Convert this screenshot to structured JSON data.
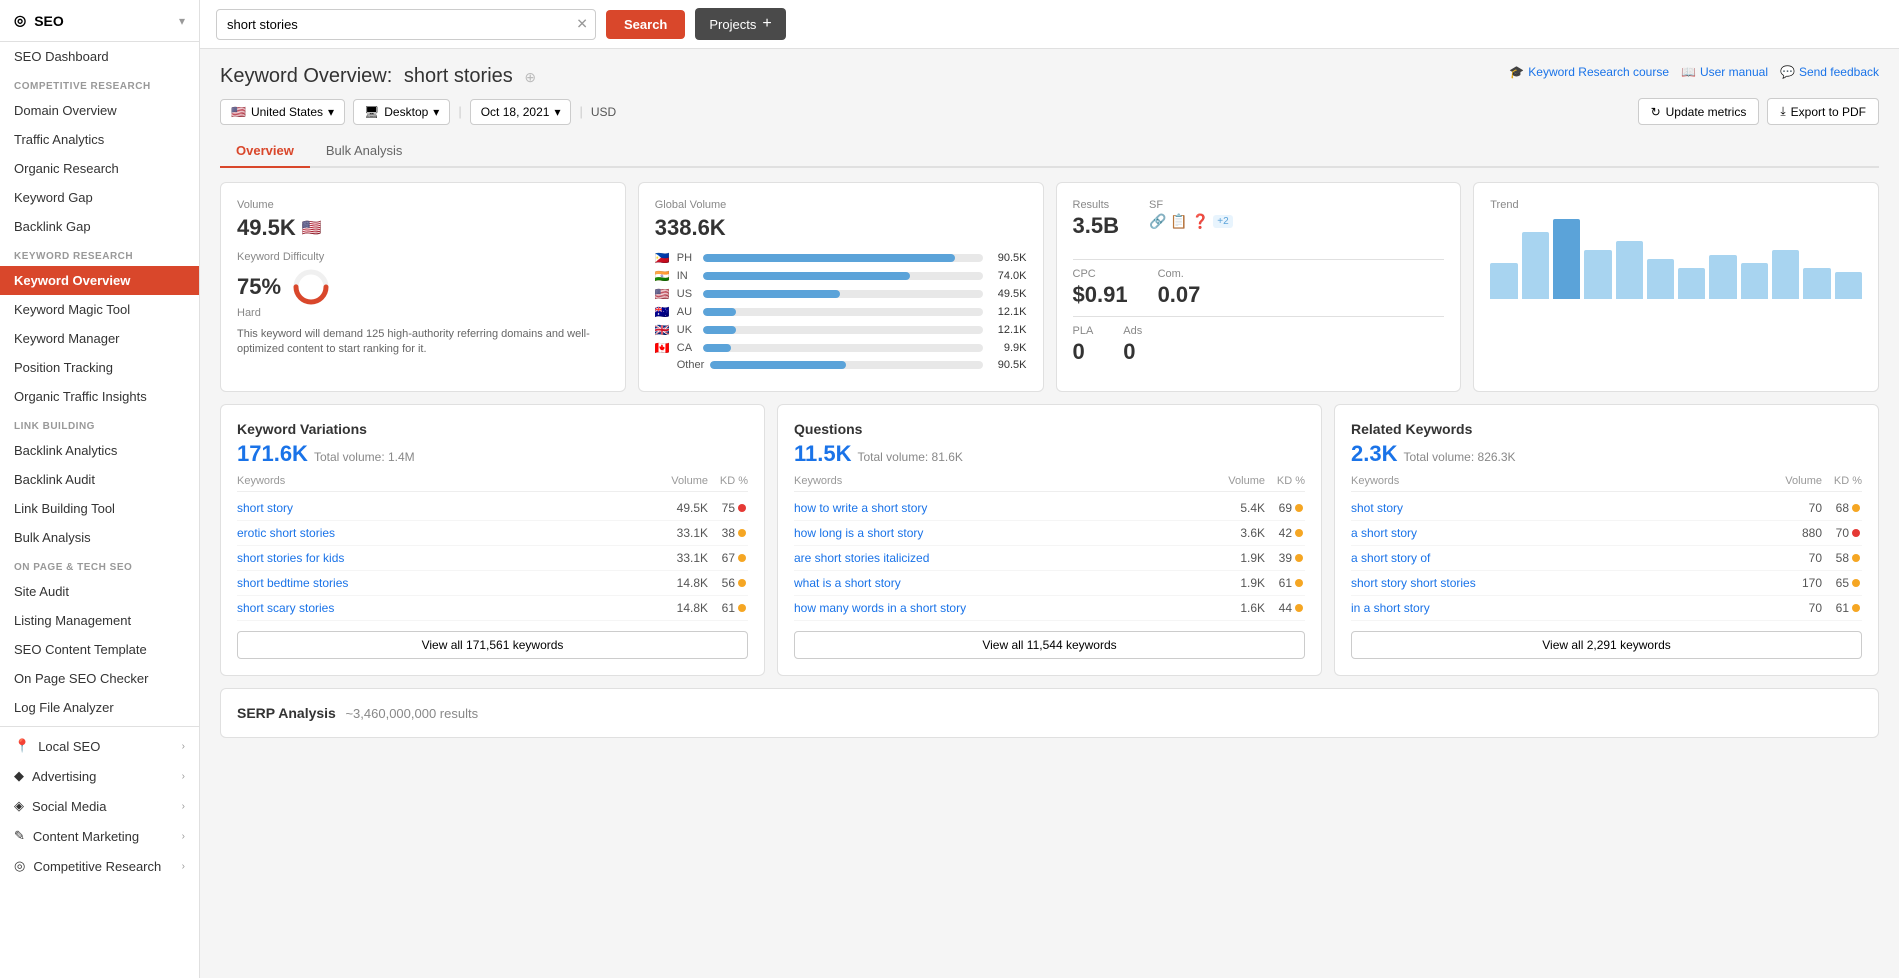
{
  "sidebar": {
    "logo": "SEO",
    "logo_icon": "◎",
    "chevron": "▾",
    "dashboard_item": "SEO Dashboard",
    "sections": [
      {
        "label": "COMPETITIVE RESEARCH",
        "items": [
          {
            "id": "domain-overview",
            "label": "Domain Overview",
            "active": false
          },
          {
            "id": "traffic-analytics",
            "label": "Traffic Analytics",
            "active": false
          },
          {
            "id": "organic-research",
            "label": "Organic Research",
            "active": false
          },
          {
            "id": "keyword-gap",
            "label": "Keyword Gap",
            "active": false
          },
          {
            "id": "backlink-gap",
            "label": "Backlink Gap",
            "active": false
          }
        ]
      },
      {
        "label": "KEYWORD RESEARCH",
        "items": [
          {
            "id": "keyword-overview",
            "label": "Keyword Overview",
            "active": true
          },
          {
            "id": "keyword-magic-tool",
            "label": "Keyword Magic Tool",
            "active": false
          },
          {
            "id": "keyword-manager",
            "label": "Keyword Manager",
            "active": false
          },
          {
            "id": "position-tracking",
            "label": "Position Tracking",
            "active": false
          },
          {
            "id": "organic-traffic-insights",
            "label": "Organic Traffic Insights",
            "active": false
          }
        ]
      },
      {
        "label": "LINK BUILDING",
        "items": [
          {
            "id": "backlink-analytics",
            "label": "Backlink Analytics",
            "active": false
          },
          {
            "id": "backlink-audit",
            "label": "Backlink Audit",
            "active": false
          },
          {
            "id": "link-building-tool",
            "label": "Link Building Tool",
            "active": false
          },
          {
            "id": "bulk-analysis",
            "label": "Bulk Analysis",
            "active": false
          }
        ]
      },
      {
        "label": "ON PAGE & TECH SEO",
        "items": [
          {
            "id": "site-audit",
            "label": "Site Audit",
            "active": false
          },
          {
            "id": "listing-management",
            "label": "Listing Management",
            "active": false
          },
          {
            "id": "seo-content-template",
            "label": "SEO Content Template",
            "active": false
          },
          {
            "id": "on-page-seo-checker",
            "label": "On Page SEO Checker",
            "active": false
          },
          {
            "id": "log-file-analyzer",
            "label": "Log File Analyzer",
            "active": false
          }
        ]
      }
    ],
    "group_items": [
      {
        "id": "local-seo",
        "label": "Local SEO",
        "icon": "📍"
      },
      {
        "id": "advertising",
        "label": "Advertising",
        "icon": "◆"
      },
      {
        "id": "social-media",
        "label": "Social Media",
        "icon": "◈"
      },
      {
        "id": "content-marketing",
        "label": "Content Marketing",
        "icon": "✎"
      },
      {
        "id": "competitive-research",
        "label": "Competitive Research",
        "icon": "◎"
      }
    ]
  },
  "topbar": {
    "search_placeholder": "short stories",
    "search_value": "short stories",
    "search_button": "Search",
    "projects_button": "Projects"
  },
  "page": {
    "title_prefix": "Keyword Overview:",
    "keyword": "short stories",
    "info_icon": "⊕",
    "links": [
      {
        "id": "keyword-research-course",
        "label": "Keyword Research course",
        "icon": "🎓"
      },
      {
        "id": "user-manual",
        "label": "User manual",
        "icon": "📖"
      },
      {
        "id": "send-feedback",
        "label": "Send feedback",
        "icon": "💬"
      }
    ],
    "filters": {
      "country": "United States",
      "device": "Desktop",
      "date": "Oct 18, 2021",
      "currency": "USD"
    },
    "action_buttons": [
      {
        "id": "update-metrics",
        "label": "Update metrics",
        "icon": "↻"
      },
      {
        "id": "export-pdf",
        "label": "Export to PDF",
        "icon": "⤓"
      }
    ],
    "tabs": [
      {
        "id": "overview",
        "label": "Overview",
        "active": true
      },
      {
        "id": "bulk-analysis",
        "label": "Bulk Analysis",
        "active": false
      }
    ]
  },
  "metrics": {
    "volume": {
      "label": "Volume",
      "value": "49.5K",
      "flag": "🇺🇸"
    },
    "keyword_difficulty": {
      "label": "Keyword Difficulty",
      "value": "75%",
      "badge": "Hard",
      "percent": 75,
      "description": "This keyword will demand 125 high-authority referring domains and well-optimized content to start ranking for it."
    },
    "global_volume": {
      "label": "Global Volume",
      "value": "338.6K",
      "countries": [
        {
          "flag": "🇵🇭",
          "code": "PH",
          "value": "90.5K",
          "pct": 90
        },
        {
          "flag": "🇮🇳",
          "code": "IN",
          "value": "74.0K",
          "pct": 74
        },
        {
          "flag": "🇺🇸",
          "code": "US",
          "value": "49.5K",
          "pct": 49
        },
        {
          "flag": "🇦🇺",
          "code": "AU",
          "value": "12.1K",
          "pct": 12
        },
        {
          "flag": "🇬🇧",
          "code": "UK",
          "value": "12.1K",
          "pct": 12
        },
        {
          "flag": "🇨🇦",
          "code": "CA",
          "value": "9.9K",
          "pct": 10
        },
        {
          "flag": "",
          "code": "Other",
          "value": "90.5K",
          "pct": 50
        }
      ]
    },
    "results": {
      "label": "Results",
      "value": "3.5B",
      "sf_label": "SF",
      "icons": [
        "🔗",
        "📋",
        "❓"
      ],
      "badge": "+2"
    },
    "cpc": {
      "label": "CPC",
      "value": "$0.91",
      "com_label": "Com.",
      "com_value": "0.07",
      "pla_label": "PLA",
      "pla_value": "0",
      "ads_label": "Ads",
      "ads_value": "0"
    },
    "trend": {
      "label": "Trend",
      "bars": [
        40,
        75,
        90,
        55,
        65,
        45,
        35,
        50,
        40,
        55,
        35,
        30
      ],
      "colors": [
        "#a8d4f0",
        "#a8d4f0",
        "#5ba3d9",
        "#a8d4f0",
        "#a8d4f0",
        "#a8d4f0",
        "#a8d4f0",
        "#a8d4f0",
        "#a8d4f0",
        "#a8d4f0",
        "#a8d4f0",
        "#a8d4f0"
      ]
    }
  },
  "keyword_variations": {
    "section_title": "Keyword Variations",
    "count": "171.6K",
    "total_volume_label": "Total volume:",
    "total_volume": "1.4M",
    "col_keywords": "Keywords",
    "col_volume": "Volume",
    "col_kd": "KD %",
    "rows": [
      {
        "keyword": "short story",
        "volume": "49.5K",
        "kd": 75,
        "kd_color": "#e53935"
      },
      {
        "keyword": "erotic short stories",
        "volume": "33.1K",
        "kd": 38,
        "kd_color": "#f5a623"
      },
      {
        "keyword": "short stories for kids",
        "volume": "33.1K",
        "kd": 67,
        "kd_color": "#f5a623"
      },
      {
        "keyword": "short bedtime stories",
        "volume": "14.8K",
        "kd": 56,
        "kd_color": "#f5a623"
      },
      {
        "keyword": "short scary stories",
        "volume": "14.8K",
        "kd": 61,
        "kd_color": "#f5a623"
      }
    ],
    "view_all": "View all 171,561 keywords"
  },
  "questions": {
    "section_title": "Questions",
    "count": "11.5K",
    "total_volume_label": "Total volume:",
    "total_volume": "81.6K",
    "col_keywords": "Keywords",
    "col_volume": "Volume",
    "col_kd": "KD %",
    "rows": [
      {
        "keyword": "how to write a short story",
        "volume": "5.4K",
        "kd": 69,
        "kd_color": "#f5a623"
      },
      {
        "keyword": "how long is a short story",
        "volume": "3.6K",
        "kd": 42,
        "kd_color": "#f5a623"
      },
      {
        "keyword": "are short stories italicized",
        "volume": "1.9K",
        "kd": 39,
        "kd_color": "#f5a623"
      },
      {
        "keyword": "what is a short story",
        "volume": "1.9K",
        "kd": 61,
        "kd_color": "#f5a623"
      },
      {
        "keyword": "how many words in a short story",
        "volume": "1.6K",
        "kd": 44,
        "kd_color": "#f5a623"
      }
    ],
    "view_all": "View all 11,544 keywords"
  },
  "related_keywords": {
    "section_title": "Related Keywords",
    "count": "2.3K",
    "total_volume_label": "Total volume:",
    "total_volume": "826.3K",
    "col_keywords": "Keywords",
    "col_volume": "Volume",
    "col_kd": "KD %",
    "rows": [
      {
        "keyword": "shot story",
        "volume": "70",
        "kd": 68,
        "kd_color": "#f5a623"
      },
      {
        "keyword": "a short story",
        "volume": "880",
        "kd": 70,
        "kd_color": "#e53935"
      },
      {
        "keyword": "a short story of",
        "volume": "70",
        "kd": 58,
        "kd_color": "#f5a623"
      },
      {
        "keyword": "short story short stories",
        "volume": "170",
        "kd": 65,
        "kd_color": "#f5a623"
      },
      {
        "keyword": "in a short story",
        "volume": "70",
        "kd": 61,
        "kd_color": "#f5a623"
      }
    ],
    "view_all": "View all 2,291 keywords"
  },
  "serp": {
    "title": "SERP Analysis",
    "count": "~3,460,000,000 results"
  }
}
